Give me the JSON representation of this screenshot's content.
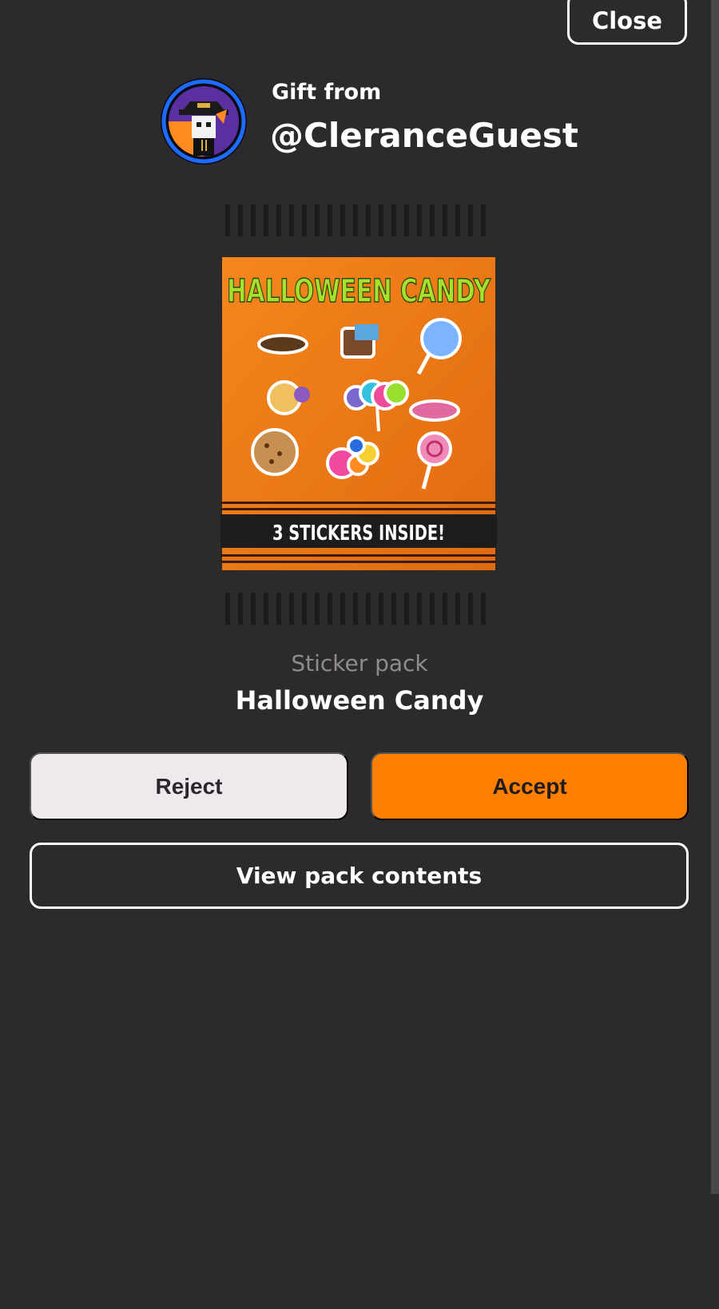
{
  "header": {
    "close_label": "Close"
  },
  "gift": {
    "from_label": "Gift from",
    "sender": "@CleranceGuest"
  },
  "pack": {
    "art_title": "HALLOWEEN CANDY",
    "art_banner": "3 STICKERS INSIDE!",
    "type_label": "Sticker pack",
    "name": "Halloween Candy"
  },
  "actions": {
    "reject_label": "Reject",
    "accept_label": "Accept",
    "view_label": "View pack contents"
  },
  "colors": {
    "background": "#2d2a2e",
    "accent": "#ff7f00",
    "reject_bg": "#efe9ee",
    "pack_orange": "#f07a1a"
  }
}
